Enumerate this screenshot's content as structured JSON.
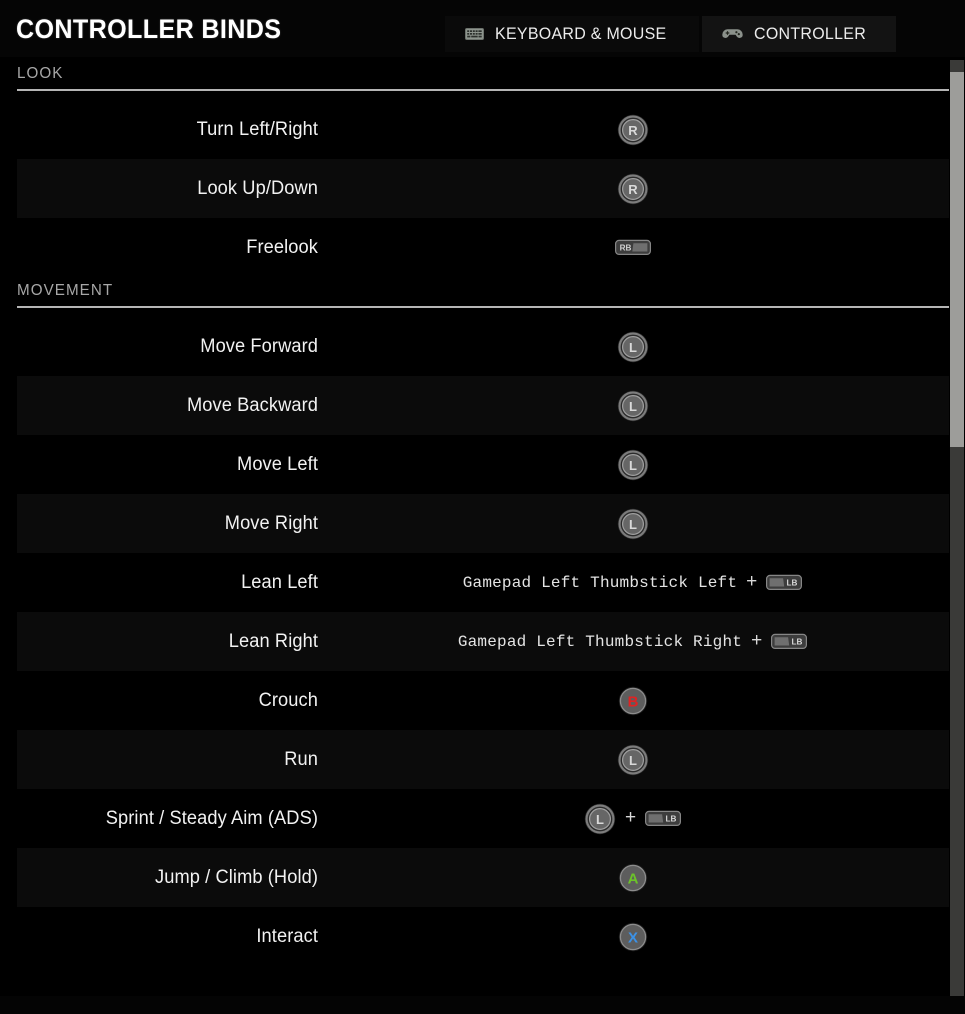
{
  "header": {
    "title": "CONTROLLER BINDS",
    "tabs": [
      {
        "label": "KEYBOARD & MOUSE",
        "icon": "keyboard-icon",
        "active": false
      },
      {
        "label": "CONTROLLER",
        "icon": "gamepad-icon",
        "active": true
      }
    ]
  },
  "colors": {
    "button_a": "#6cc329",
    "button_b": "#e02222",
    "button_x": "#3b92e8",
    "glyph_body": "#5e5e5e",
    "glyph_ring": "#8c8c8c",
    "section_text": "#a7a7a7",
    "label_text": "#f2f2f2",
    "background": "#000000"
  },
  "sections": [
    {
      "title": "LOOK",
      "rows": [
        {
          "label": "Turn Left/Right",
          "value_text": "",
          "glyphs": [
            "stick-r"
          ]
        },
        {
          "label": "Look Up/Down",
          "value_text": "",
          "glyphs": [
            "stick-r"
          ]
        },
        {
          "label": "Freelook",
          "value_text": "",
          "glyphs": [
            "bumper-rb"
          ]
        }
      ]
    },
    {
      "title": "MOVEMENT",
      "rows": [
        {
          "label": "Move Forward",
          "value_text": "",
          "glyphs": [
            "stick-l"
          ]
        },
        {
          "label": "Move Backward",
          "value_text": "",
          "glyphs": [
            "stick-l"
          ]
        },
        {
          "label": "Move Left",
          "value_text": "",
          "glyphs": [
            "stick-l"
          ]
        },
        {
          "label": "Move Right",
          "value_text": "",
          "glyphs": [
            "stick-l"
          ]
        },
        {
          "label": "Lean Left",
          "value_text": "Gamepad Left Thumbstick Left",
          "separator": "+",
          "glyphs": [
            "bumper-lb"
          ]
        },
        {
          "label": "Lean Right",
          "value_text": "Gamepad Left Thumbstick Right",
          "separator": "+",
          "glyphs": [
            "bumper-lb"
          ]
        },
        {
          "label": "Crouch",
          "value_text": "",
          "glyphs": [
            "button-b"
          ]
        },
        {
          "label": "Run",
          "value_text": "",
          "glyphs": [
            "stick-l"
          ]
        },
        {
          "label": "Sprint / Steady Aim (ADS)",
          "value_text": "",
          "separator": "+",
          "glyphs": [
            "stick-l",
            "bumper-lb"
          ]
        },
        {
          "label": "Jump / Climb (Hold)",
          "value_text": "",
          "glyphs": [
            "button-a"
          ]
        },
        {
          "label": "Interact",
          "value_text": "",
          "glyphs": [
            "button-x"
          ]
        }
      ]
    }
  ],
  "scrollbar": {
    "thumb_top_pct": 1.3,
    "thumb_height_pct": 39.3
  }
}
